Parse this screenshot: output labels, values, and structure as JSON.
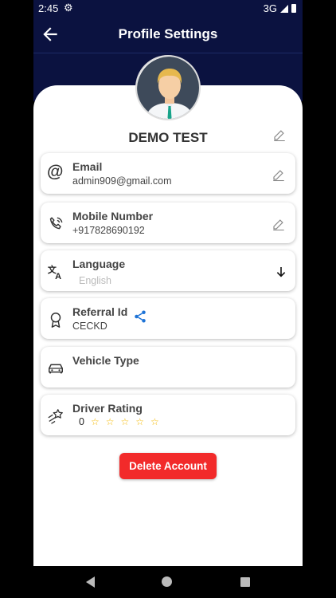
{
  "status_bar": {
    "time": "2:45",
    "network": "3G"
  },
  "app_bar": {
    "title": "Profile Settings"
  },
  "profile": {
    "name": "DEMO TEST"
  },
  "fields": {
    "email": {
      "label": "Email",
      "value": "admin909@gmail.com"
    },
    "mobile": {
      "label": "Mobile Number",
      "value": "+917828690192"
    },
    "language": {
      "label": "Language",
      "value": "English"
    },
    "referral": {
      "label": "Referral Id",
      "value": "CECKD"
    },
    "vehicle": {
      "label": "Vehicle Type",
      "value": ""
    },
    "rating": {
      "label": "Driver Rating",
      "value": "0",
      "stars": 5,
      "filled": 0
    }
  },
  "delete_button": {
    "label": "Delete Account"
  },
  "colors": {
    "header": "#0b1240",
    "danger": "#f22a2a",
    "accent": "#1e73d6",
    "star": "#f5b800"
  }
}
